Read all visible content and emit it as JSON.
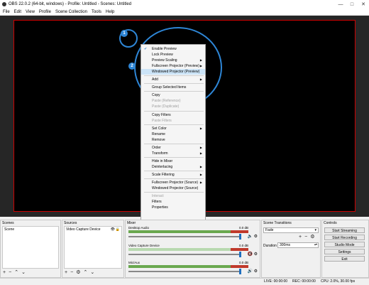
{
  "window": {
    "title": "OBS 22.0.2 (64-bit, windows) - Profile: Untitled - Scenes: Untitled"
  },
  "menu": [
    "File",
    "Edit",
    "View",
    "Profile",
    "Scene Collection",
    "Tools",
    "Help"
  ],
  "callouts": [
    "1",
    "2"
  ],
  "context_menu": [
    {
      "label": "Enable Preview",
      "checked": true
    },
    {
      "label": "Lock Preview"
    },
    {
      "label": "Preview Scaling",
      "submenu": true
    },
    {
      "label": "Fullscreen Projector (Preview)",
      "submenu": true
    },
    {
      "label": "Windowed Projector (Preview)",
      "highlighted": true
    },
    {
      "sep": true
    },
    {
      "label": "Add",
      "submenu": true
    },
    {
      "sep": true
    },
    {
      "label": "Group Selected Items"
    },
    {
      "sep": true
    },
    {
      "label": "Copy"
    },
    {
      "label": "Paste (Reference)",
      "disabled": true
    },
    {
      "label": "Paste (Duplicate)",
      "disabled": true
    },
    {
      "sep": true
    },
    {
      "label": "Copy Filters"
    },
    {
      "label": "Paste Filters",
      "disabled": true
    },
    {
      "sep": true
    },
    {
      "label": "Set Color",
      "submenu": true
    },
    {
      "label": "Rename"
    },
    {
      "label": "Remove"
    },
    {
      "sep": true
    },
    {
      "label": "Order",
      "submenu": true
    },
    {
      "label": "Transform",
      "submenu": true
    },
    {
      "sep": true
    },
    {
      "label": "Hide in Mixer"
    },
    {
      "label": "Deinterlacing",
      "submenu": true
    },
    {
      "sep": true
    },
    {
      "label": "Scale Filtering",
      "submenu": true
    },
    {
      "sep": true
    },
    {
      "label": "Fullscreen Projector (Source)",
      "submenu": true
    },
    {
      "label": "Windowed Projector (Source)"
    },
    {
      "sep": true
    },
    {
      "label": "Interact",
      "disabled": true
    },
    {
      "label": "Filters"
    },
    {
      "label": "Properties"
    }
  ],
  "scenes": {
    "title": "Scenes",
    "items": [
      "Scene"
    ]
  },
  "sources": {
    "title": "Sources",
    "items": [
      "Video Capture Device"
    ]
  },
  "mixer": {
    "title": "Mixer",
    "channels": [
      {
        "name": "Desktop Audio",
        "db": "0.0 dB"
      },
      {
        "name": "Video Capture Device",
        "db": "0.0 dB"
      },
      {
        "name": "Mic/Aux",
        "db": "0.0 dB"
      }
    ]
  },
  "transitions": {
    "title": "Scene Transitions",
    "selected": "Fade",
    "duration_label": "Duration",
    "duration_value": "300ms"
  },
  "controls": {
    "title": "Controls",
    "buttons": [
      "Start Streaming",
      "Start Recording",
      "Studio Mode",
      "Settings",
      "Exit"
    ]
  },
  "status": {
    "live": "LIVE: 00:00:00",
    "rec": "REC: 00:00:00",
    "cpu": "CPU: 2.0%, 30.00 fps"
  },
  "colors": {
    "accent": "#2e86d6",
    "preview_border": "#cc0000"
  }
}
